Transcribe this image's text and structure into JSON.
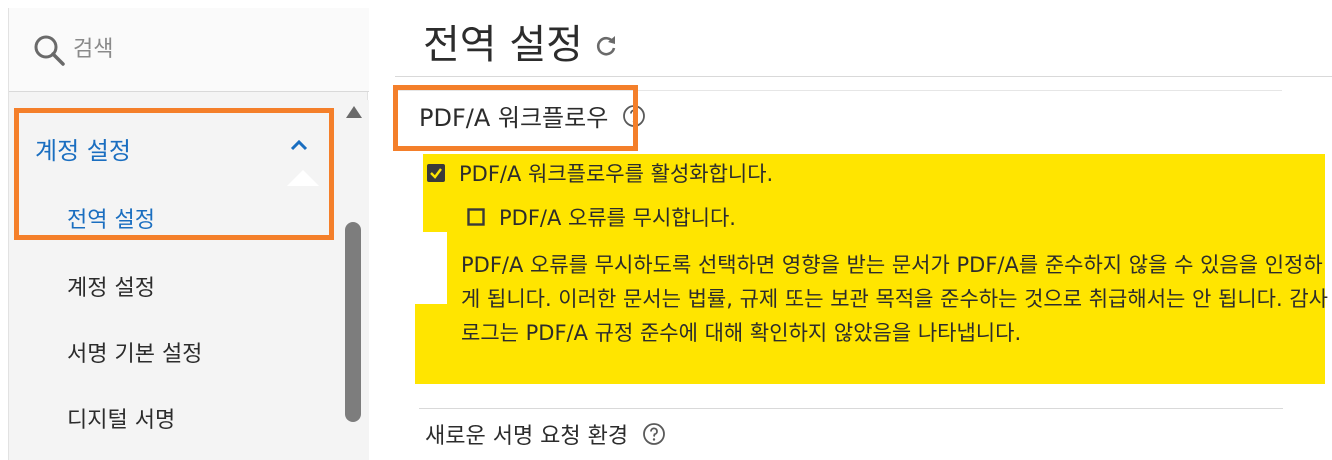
{
  "search": {
    "placeholder": "검색"
  },
  "sidebar": {
    "group_label": "계정 설정",
    "items": [
      {
        "label": "전역 설정",
        "active": true
      },
      {
        "label": "계정 설정",
        "active": false
      },
      {
        "label": "서명 기본 설정",
        "active": false
      },
      {
        "label": "디지털 서명",
        "active": false
      }
    ]
  },
  "main": {
    "page_title": "전역 설정",
    "pdfa_section": {
      "heading": "PDF/A 워크플로우",
      "enable_label": "PDF/A 워크플로우를 활성화합니다.",
      "enable_checked": true,
      "ignore_label": "PDF/A 오류를 무시합니다.",
      "ignore_checked": false,
      "description": "PDF/A 오류를 무시하도록 선택하면 영향을 받는 문서가 PDF/A를 준수하지 않을 수 있음을 인정하게 됩니다. 이러한 문서는 법률, 규제 또는 보관 목적을 준수하는 것으로 취급해서는 안 됩니다. 감사 로그는 PDF/A 규정 준수에 대해 확인하지 않았음을 나타냅니다."
    },
    "next_section": {
      "heading": "새로운 서명 요청 환경"
    }
  },
  "colors": {
    "accent_blue": "#1a6ec0",
    "annotation_orange": "#f47f2a",
    "highlight_yellow": "#ffe500",
    "checkbox_dark": "#3a3a3a"
  },
  "icons": [
    "search-icon",
    "chevron-up-icon",
    "refresh-icon",
    "help-icon",
    "checkbox-checked-icon",
    "checkbox-empty-icon",
    "scroll-up-arrow"
  ]
}
